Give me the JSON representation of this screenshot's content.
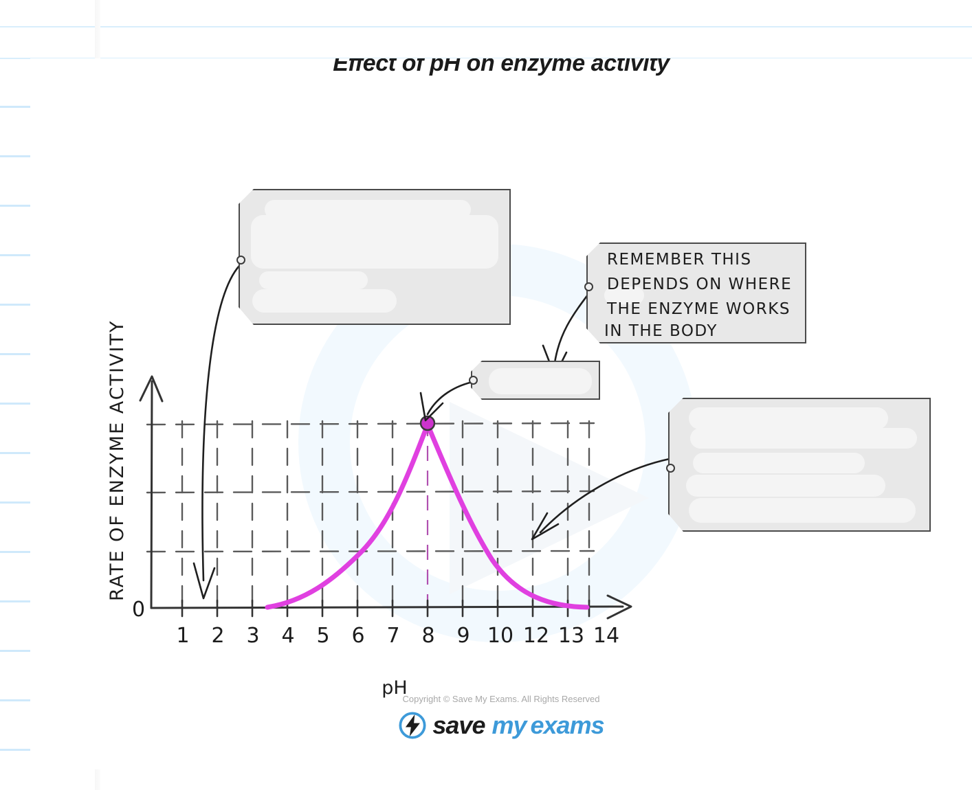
{
  "page": {
    "background": "notebook-paper",
    "rule_color": "#cfe9fb",
    "card_color": "#ffffff"
  },
  "title": "Effect of pH on enzyme activity",
  "colors": {
    "curve": "#e040e0",
    "axis": "#333333",
    "grid": "#555555",
    "tag_fill": "#e8e8e8",
    "tag_border": "#4a4a4a",
    "brand_blue": "#3d9ad9",
    "copyright_grey": "#a8a8a8"
  },
  "annotations": [
    {
      "id": "annotation-top-left",
      "lines": [],
      "redacted": true,
      "note": "text erased / blanked out"
    },
    {
      "id": "annotation-remember",
      "redacted": false,
      "lines": [
        "REMEMBER   THIS",
        "DEPENDS  ON  WHERE",
        "THE  ENZYME  WORKS",
        "IN  THE  BODY"
      ]
    },
    {
      "id": "annotation-peak-tag",
      "lines": [],
      "redacted": true,
      "note": "small empty tag pointing at optimum pH"
    },
    {
      "id": "annotation-right",
      "lines": [],
      "redacted": true,
      "note": "text erased / blanked out"
    }
  ],
  "chart_data": {
    "type": "line",
    "title": "Effect of pH on enzyme activity",
    "xlabel": "pH",
    "ylabel": "RATE OF ENZYME ACTIVITY",
    "y_origin_label": "0",
    "xticks": [
      "1",
      "2",
      "3",
      "4",
      "5",
      "6",
      "7",
      "8",
      "9",
      "10",
      "12",
      "13",
      "14"
    ],
    "xlim": [
      0,
      14
    ],
    "ylim": [
      0,
      1.15
    ],
    "grid": "dashed",
    "gridlines_y": [
      0.33,
      0.66,
      1.0
    ],
    "legend": "none",
    "series": [
      {
        "name": "Rate of enzyme activity",
        "color": "#e040e0",
        "x": [
          2.6,
          3,
          3.5,
          4,
          4.5,
          5,
          5.5,
          6,
          6.5,
          7,
          7.5,
          8,
          8.5,
          9,
          9.5,
          10,
          10.5,
          11,
          11.5,
          12,
          12.5,
          13
        ],
        "y": [
          0.0,
          0.07,
          0.14,
          0.22,
          0.3,
          0.39,
          0.49,
          0.6,
          0.72,
          0.84,
          0.95,
          1.0,
          0.97,
          0.88,
          0.76,
          0.62,
          0.48,
          0.35,
          0.24,
          0.15,
          0.07,
          0.0
        ]
      }
    ],
    "markers": [
      {
        "name": "optimum-point",
        "x": 8,
        "y": 1.0,
        "color": "#cc33cc",
        "label": ""
      }
    ],
    "guide_lines": [
      {
        "name": "optimum-ph-dashed",
        "orientation": "vertical",
        "x": 8,
        "color": "#b050b0"
      }
    ]
  },
  "footer": {
    "copyright": "Copyright © Save My Exams. All Rights Reserved",
    "logo": {
      "save": "save",
      "my": "my",
      "exams": "exams",
      "icon": "lightning-bolt-icon"
    }
  }
}
